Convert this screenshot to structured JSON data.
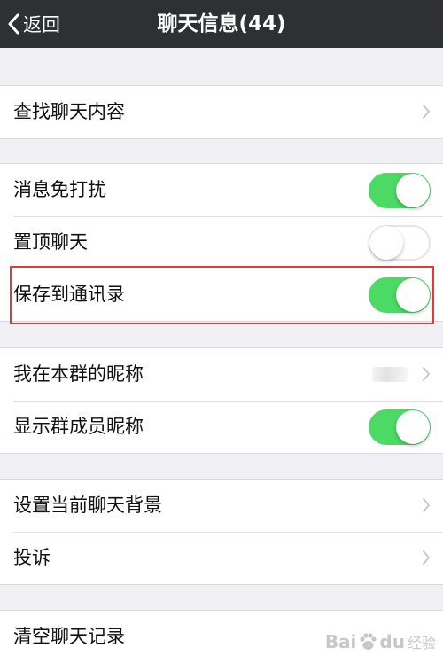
{
  "navbar": {
    "back_label": "返回",
    "title": "聊天信息(44)"
  },
  "groups": {
    "search": {
      "find_label": "查找聊天内容"
    },
    "settings": {
      "mute_label": "消息免打扰",
      "mute_on": true,
      "pin_label": "置顶聊天",
      "pin_on": false,
      "save_label": "保存到通讯录",
      "save_on": true
    },
    "group_info": {
      "nickname_label": "我在本群的昵称",
      "show_nicknames_label": "显示群成员昵称",
      "show_nicknames_on": true
    },
    "background": {
      "set_bg_label": "设置当前聊天背景",
      "complain_label": "投诉"
    },
    "clear": {
      "clear_label": "清空聊天记录"
    }
  },
  "colors": {
    "navbar": "#2f3034",
    "toggle_on": "#4cd964",
    "highlight": "#e0393e",
    "background": "#efeff4"
  },
  "watermark": {
    "brand": "Bai",
    "brand_end": "du",
    "sub": "经验"
  },
  "icons": [
    "back-chevron-icon",
    "chevron-right-icon",
    "baidu-paw-icon"
  ]
}
